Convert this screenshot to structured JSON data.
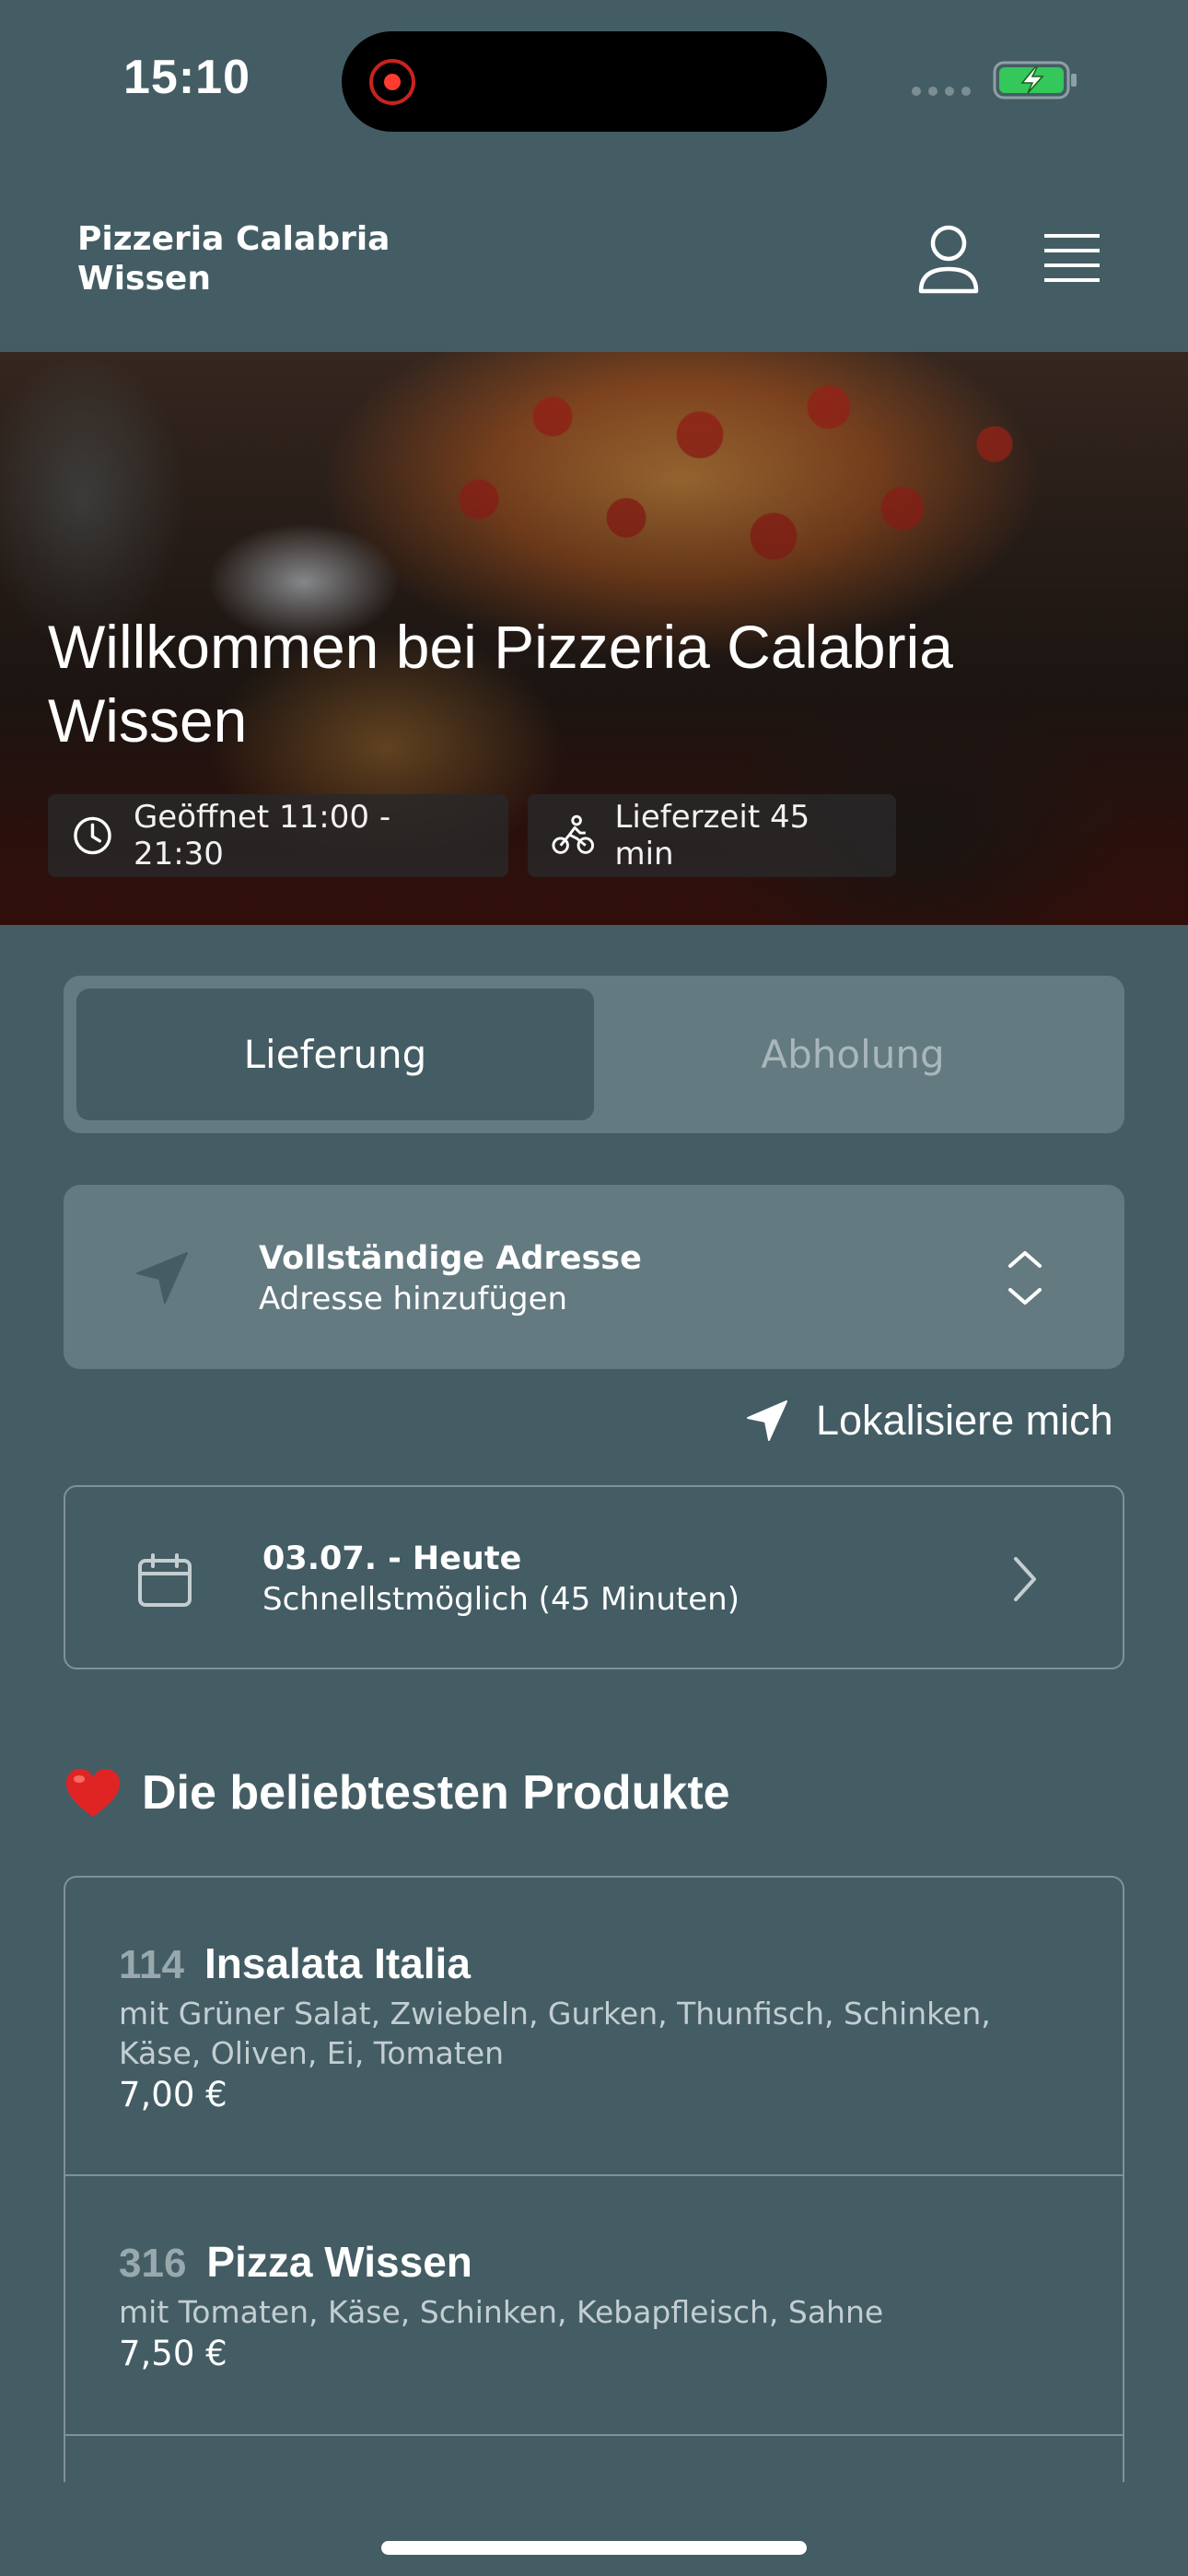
{
  "status_bar": {
    "time": "15:10"
  },
  "header": {
    "brand": "Pizzeria Calabria Wissen",
    "user_icon": "user-icon",
    "menu_icon": "hamburger-menu-icon"
  },
  "hero": {
    "title": "Willkommen bei Pizzeria Calabria Wissen",
    "open_label": "Geöffnet 11:00 - 21:30",
    "delivery_label": "Lieferzeit 45 min"
  },
  "order_type": {
    "delivery": "Lieferung",
    "pickup": "Abholung",
    "selected": "delivery"
  },
  "address": {
    "title": "Vollständige Adresse",
    "subtitle": "Adresse hinzufügen"
  },
  "locate": {
    "label": "Lokalisiere mich"
  },
  "time": {
    "title": "03.07. - Heute",
    "subtitle": "Schnellstmöglich (45 Minuten)"
  },
  "popular": {
    "title": "Die beliebtesten Produkte",
    "items": [
      {
        "number": "114",
        "name": "Insalata Italia",
        "description": "mit Grüner Salat, Zwiebeln, Gurken, Thunfisch, Schinken, Käse, Oliven, Ei, Tomaten",
        "price": "7,00 €"
      },
      {
        "number": "316",
        "name": "Pizza Wissen",
        "description": "mit Tomaten, Käse, Schinken, Kebapfleisch, Sahne",
        "price": "7,50 €"
      }
    ]
  },
  "colors": {
    "background": "#445d64",
    "card": "#637a80",
    "accent_heart": "#e02424",
    "battery": "#34c759"
  }
}
